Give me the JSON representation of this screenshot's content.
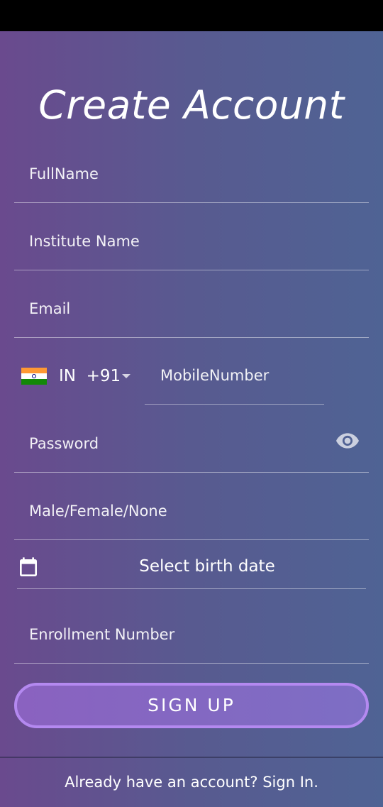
{
  "title": "Create Account",
  "fields": {
    "full_name": "FullName",
    "institute_name": "Institute Name",
    "email": "Email",
    "password": "Password",
    "gender": "Male/Female/None",
    "enrollment_number": "Enrollment Number"
  },
  "phone": {
    "country": "IN",
    "dial_code": "+91",
    "country_display": "IN  +91",
    "flag_icon": "india-flag-icon",
    "mobile_placeholder": "MobileNumber"
  },
  "birth_date": {
    "icon": "calendar-icon",
    "label": "Select birth date"
  },
  "password_toggle_icon": "eye-icon",
  "signup_button": "SIGN UP",
  "signin_prompt": "Already have an account? Sign In.",
  "colors": {
    "gradient_start": "#6a4a8e",
    "gradient_end": "#4f6394",
    "button_border": "#b489f0"
  }
}
